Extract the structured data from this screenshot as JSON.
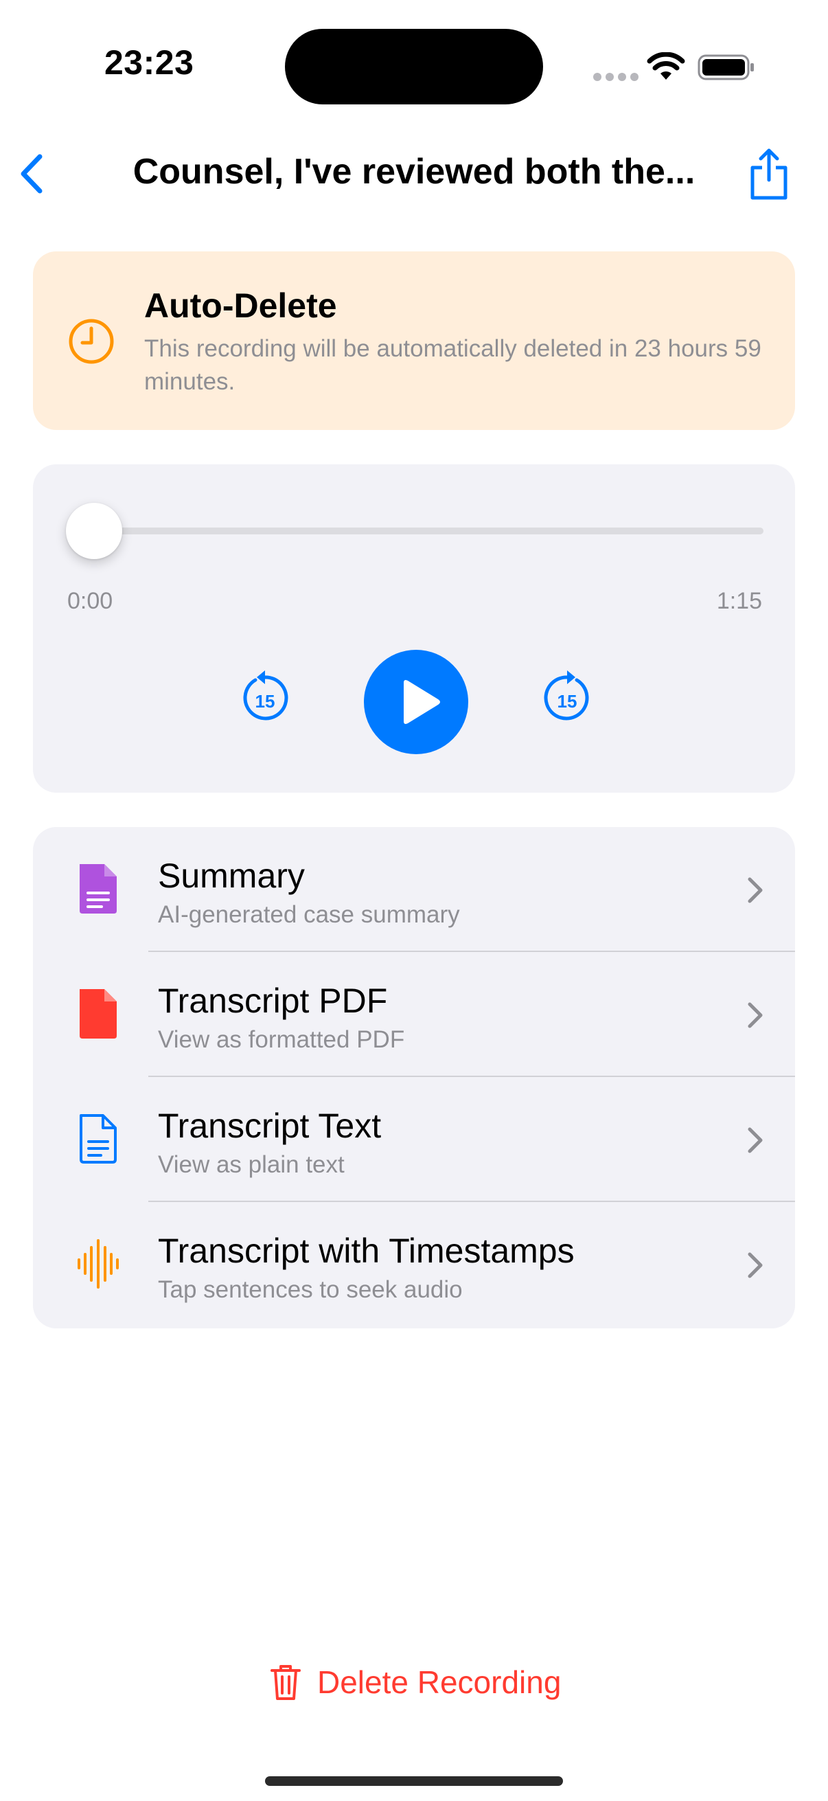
{
  "status_bar": {
    "time": "23:23"
  },
  "nav": {
    "title": "Counsel, I've reviewed both the..."
  },
  "banner": {
    "title": "Auto-Delete",
    "message": "This recording will be automatically deleted in 23 hours 59 minutes."
  },
  "player": {
    "current_time": "0:00",
    "duration": "1:15",
    "progress": 0,
    "skip_back_seconds": "15",
    "skip_forward_seconds": "15"
  },
  "options": [
    {
      "title": "Summary",
      "subtitle": "AI-generated case summary",
      "icon": "document-text-icon",
      "color": "#af52de"
    },
    {
      "title": "Transcript PDF",
      "subtitle": "View as formatted PDF",
      "icon": "document-filled-icon",
      "color": "#ff3b30"
    },
    {
      "title": "Transcript Text",
      "subtitle": "View as plain text",
      "icon": "document-outline-icon",
      "color": "#007aff"
    },
    {
      "title": "Transcript with Timestamps",
      "subtitle": "Tap sentences to seek audio",
      "icon": "waveform-icon",
      "color": "#ff9500"
    }
  ],
  "delete": {
    "label": "Delete Recording",
    "color": "#ff3b30"
  },
  "colors": {
    "accent": "#007aff",
    "warning": "#ff9500",
    "banner_bg": "#ffeedb"
  }
}
